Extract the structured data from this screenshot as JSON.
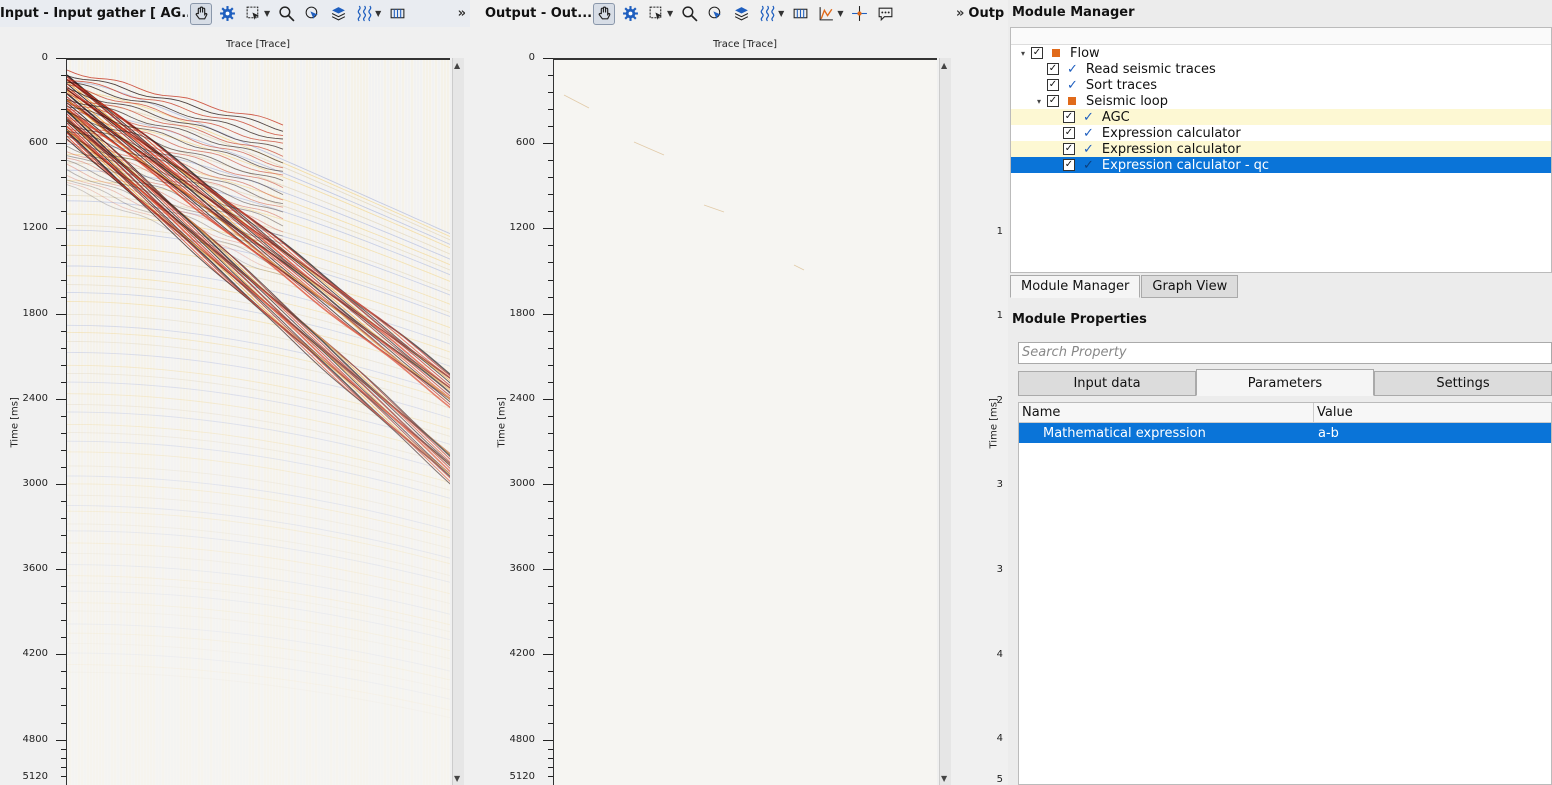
{
  "toolbars": {
    "input_title": "Input - Input gather [ AG...",
    "output_title": "Output - Out...",
    "third_title": "Outp",
    "chevron": "»"
  },
  "input_panel": {
    "axis_top": "Trace [Trace]",
    "axis_left": "Time [ms]",
    "ticks": [
      "0",
      "600",
      "1200",
      "1800",
      "2400",
      "3000",
      "3600",
      "4200",
      "4800",
      "5120"
    ]
  },
  "output_panel": {
    "axis_top": "Trace [Trace]",
    "axis_left": "Time [ms]",
    "ticks": [
      "0",
      "600",
      "1200",
      "1800",
      "2400",
      "3000",
      "3600",
      "4200",
      "4800",
      "5120"
    ]
  },
  "third_panel": {
    "axis_left": "Time [ms]",
    "ticks": [
      "1",
      "1",
      "2",
      "3",
      "3",
      "4",
      "4",
      "5"
    ]
  },
  "module_manager": {
    "title": "Module Manager",
    "tree": [
      {
        "label": "Flow",
        "level": 0,
        "marker": "square",
        "expander": "▾"
      },
      {
        "label": "Read seismic traces",
        "level": 1,
        "marker": "check"
      },
      {
        "label": "Sort traces",
        "level": 1,
        "marker": "check"
      },
      {
        "label": "Seismic loop",
        "level": 1,
        "marker": "square",
        "expander": "▾"
      },
      {
        "label": "AGC",
        "level": 2,
        "marker": "check",
        "state": "yellow"
      },
      {
        "label": "Expression calculator",
        "level": 2,
        "marker": "check"
      },
      {
        "label": "Expression calculator",
        "level": 2,
        "marker": "check",
        "state": "yellow"
      },
      {
        "label": "Expression calculator - qc",
        "level": 2,
        "marker": "check",
        "state": "selected"
      }
    ],
    "tabs": [
      "Module Manager",
      "Graph View"
    ],
    "active_tab": 0
  },
  "module_properties": {
    "title": "Module Properties",
    "search_placeholder": "Search Property",
    "tabs": [
      "Input data",
      "Parameters",
      "Settings"
    ],
    "active_tab": 1,
    "columns": {
      "name": "Name",
      "value": "Value"
    },
    "rows": [
      {
        "name": "Mathematical expression",
        "value": "a-b"
      }
    ]
  },
  "colors": {
    "selection": "#0a74d8",
    "highlight": "#fdf8d3",
    "flow_marker": "#e06a1a",
    "check_marker": "#1f5fbf"
  }
}
